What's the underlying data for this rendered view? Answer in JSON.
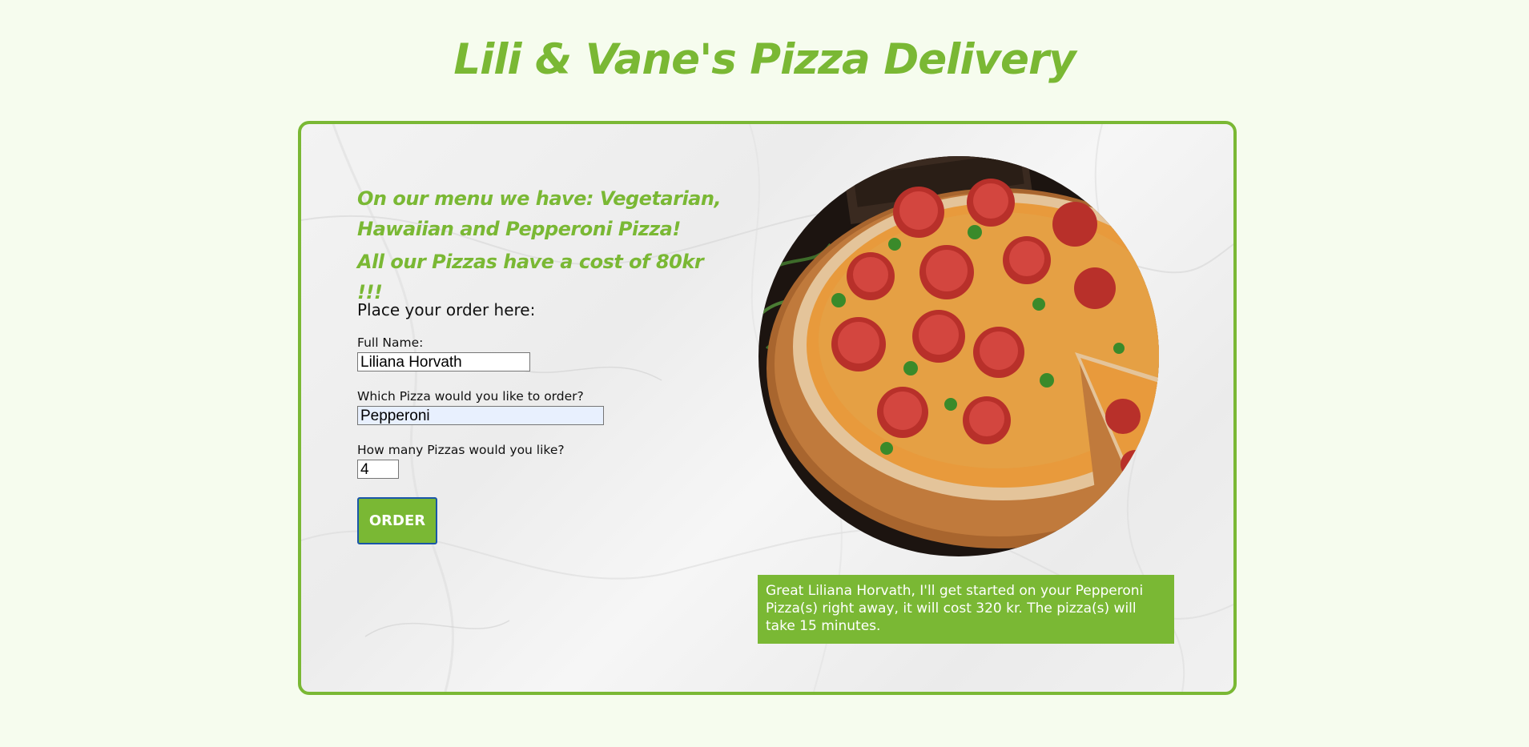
{
  "header": {
    "title": "Lili & Vane's Pizza Delivery"
  },
  "menu": {
    "description": "On our menu we have: Vegetarian, Hawaiian and Pepperoni Pizza!",
    "cost_note": "All our Pizzas have a cost of 80kr !!!"
  },
  "form": {
    "heading": "Place your order here:",
    "name_label": "Full Name:",
    "name_value": "Liliana Horvath",
    "pizza_label": "Which Pizza would you like to order?",
    "pizza_value": "Pepperoni",
    "quantity_label": "How many Pizzas would you like?",
    "quantity_value": "4",
    "submit_label": "ORDER"
  },
  "confirmation": {
    "message": "Great Liliana Horvath, I'll get started on your Pepperoni Pizza(s) right away, it will cost 320 kr. The pizza(s) will take 15 minutes."
  },
  "colors": {
    "brand_green": "#7ab834",
    "page_background": "#f6fcee",
    "focus_outline": "#1a56a8"
  }
}
